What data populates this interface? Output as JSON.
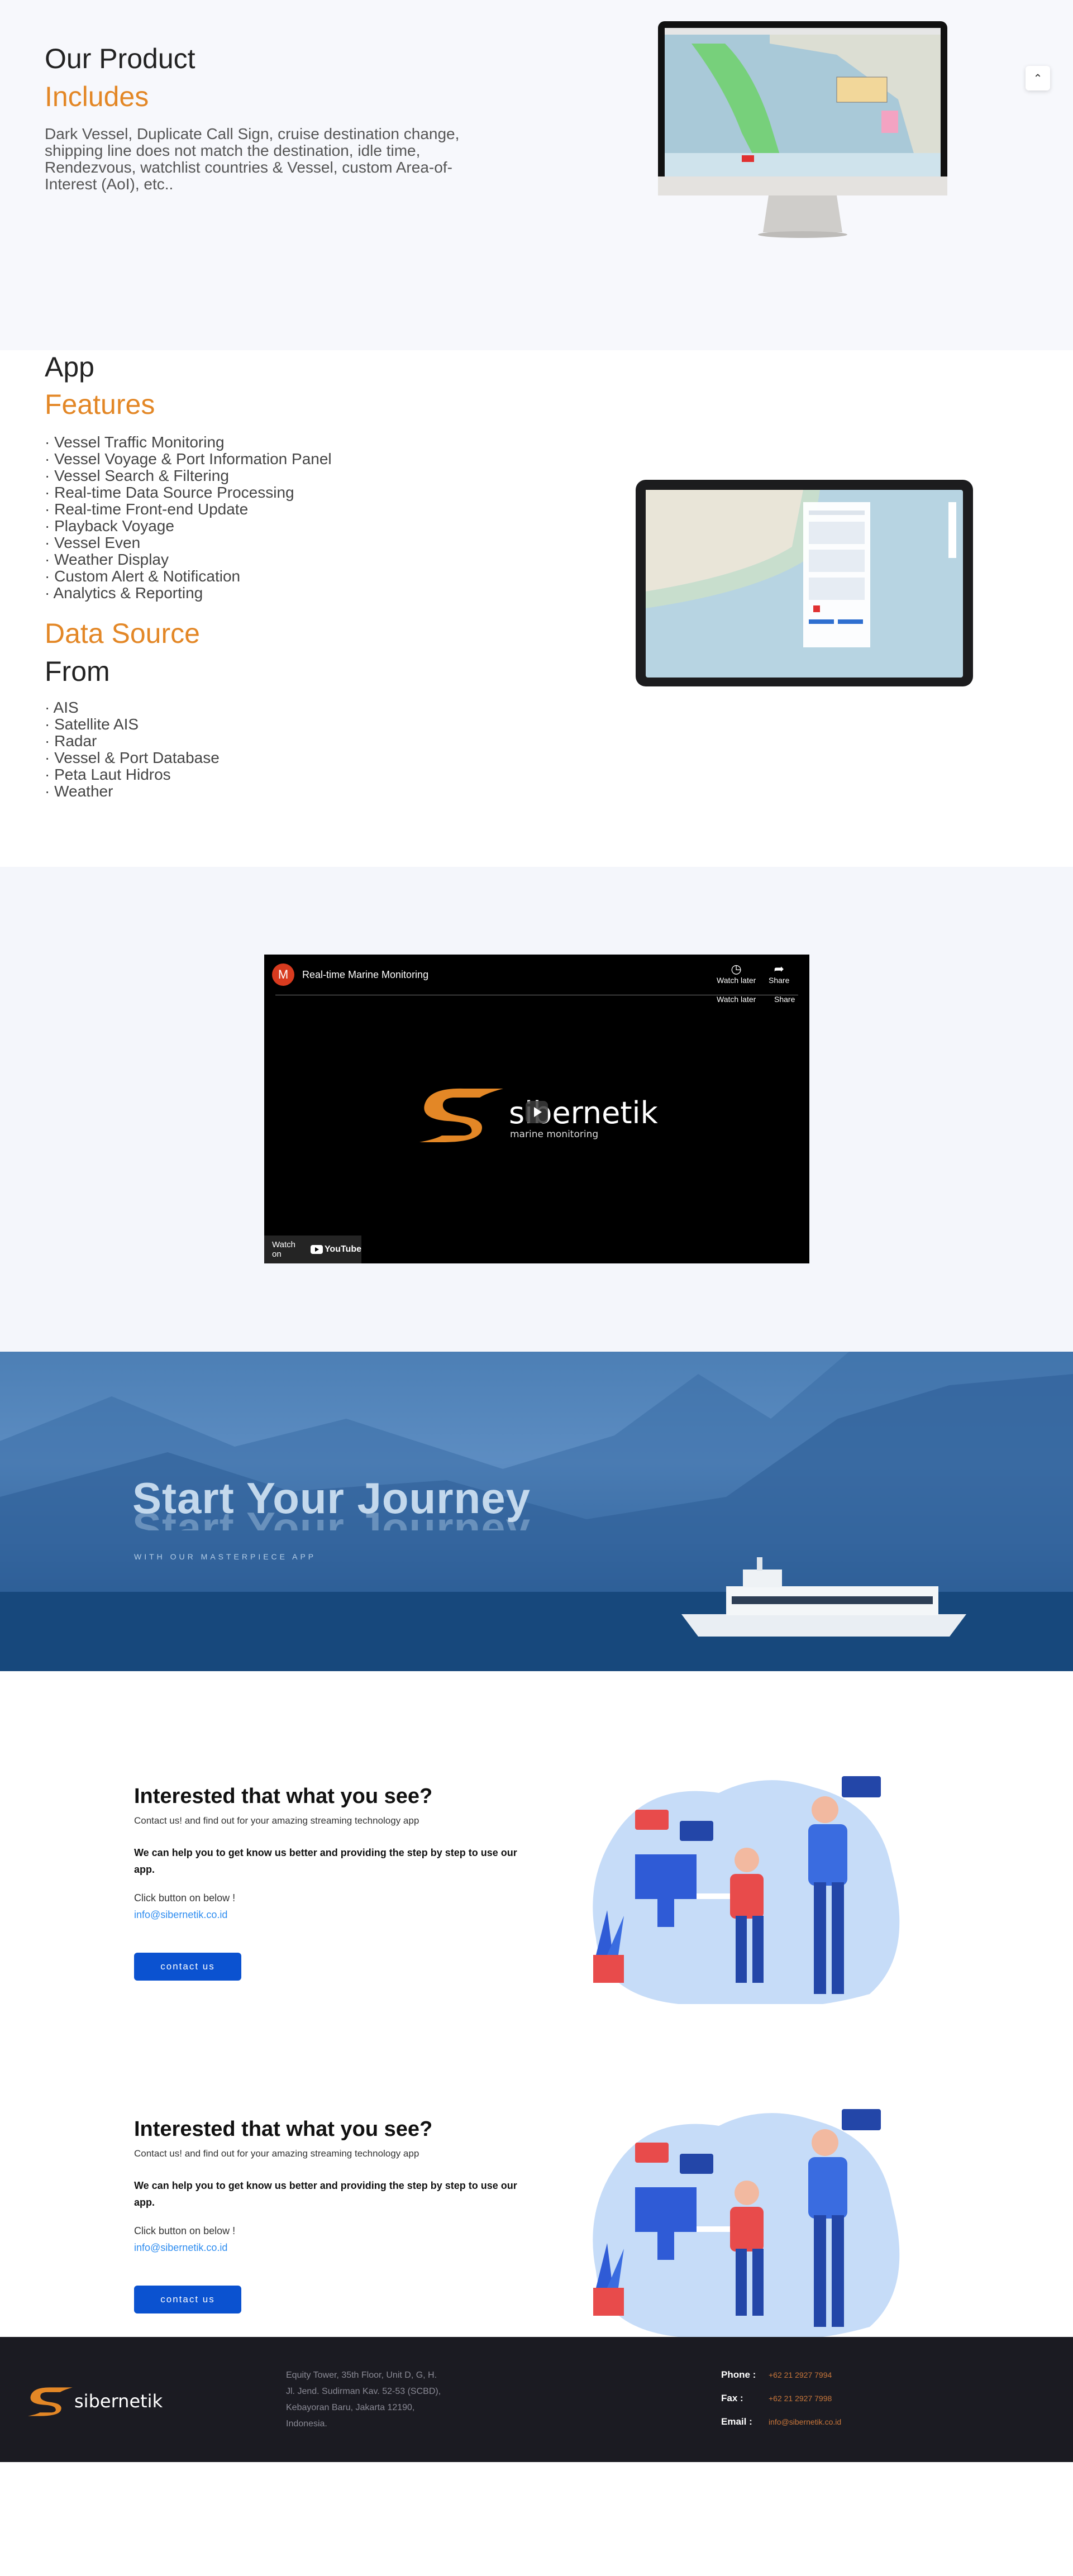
{
  "product": {
    "title_line1": "Our Product",
    "title_line2": "Includes",
    "description": "Dark Vessel, Duplicate Call Sign, cruise destination change, shipping line does not match the destination, idle time, Rendezvous, watchlist countries & Vessel, custom Area-of-Interest (AoI), etc.."
  },
  "features": {
    "title_line1": "App",
    "title_line2": "Features",
    "items": [
      "· Vessel Traffic Monitoring",
      "· Vessel Voyage & Port Information Panel",
      "· Vessel Search & Filtering",
      "· Real-time Data Source Processing",
      "· Real-time Front-end Update",
      "· Playback Voyage",
      "· Vessel Even",
      "· Weather Display",
      "· Custom Alert & Notification",
      "· Analytics & Reporting"
    ],
    "source_title_line1": "Data Source",
    "source_title_line2": "From",
    "sources": [
      "· AIS",
      "· Satellite AIS",
      "· Radar",
      "· Vessel & Port Database",
      "· Peta Laut Hidros",
      "· Weather"
    ]
  },
  "video": {
    "avatar_letter": "M",
    "title": "Real-time Marine Monitoring",
    "watch_later": "Watch later",
    "share": "Share",
    "brand_name": "sibernetik",
    "brand_tagline": "marine monitoring",
    "watch_on": "Watch on",
    "youtube": "YouTube"
  },
  "journey": {
    "title": "Start Your Journey",
    "subtitle": "WITH OUR MASTERPIECE APP"
  },
  "contact_blocks": [
    {
      "title": "Interested that what you see?",
      "subtitle": "Contact us! and find out for your amazing streaming technology app",
      "bold_text": "We can help you to get know us better and providing the step by step to use our app.",
      "click_text": "Click button on below !",
      "email": "info@sibernetik.co.id",
      "button": "contact us"
    },
    {
      "title": "Interested that what you see?",
      "subtitle": "Contact us! and find out for your amazing streaming technology app",
      "bold_text": "We can help you to get know us better and providing the step by step to use our app.",
      "click_text": "Click button on below !",
      "email": "info@sibernetik.co.id",
      "button": "contact us"
    }
  ],
  "footer": {
    "brand": "sibernetik",
    "address_lines": [
      "Equity Tower, 35th Floor, Unit D, G, H.",
      "Jl. Jend. Sudirman Kav. 52-53 (SCBD),",
      "Kebayoran Baru, Jakarta 12190,",
      "Indonesia."
    ],
    "phone_label": "Phone :",
    "phone": "+62 21 2927 7994",
    "fax_label": "Fax :",
    "fax": "+62 21 2927 7998",
    "email_label": "Email :",
    "email": "info@sibernetik.co.id"
  },
  "colors": {
    "accent_orange": "#e38726",
    "button_blue": "#0b52d0",
    "link_blue": "#2d8cf0",
    "footer_bg": "#1b1b22"
  }
}
